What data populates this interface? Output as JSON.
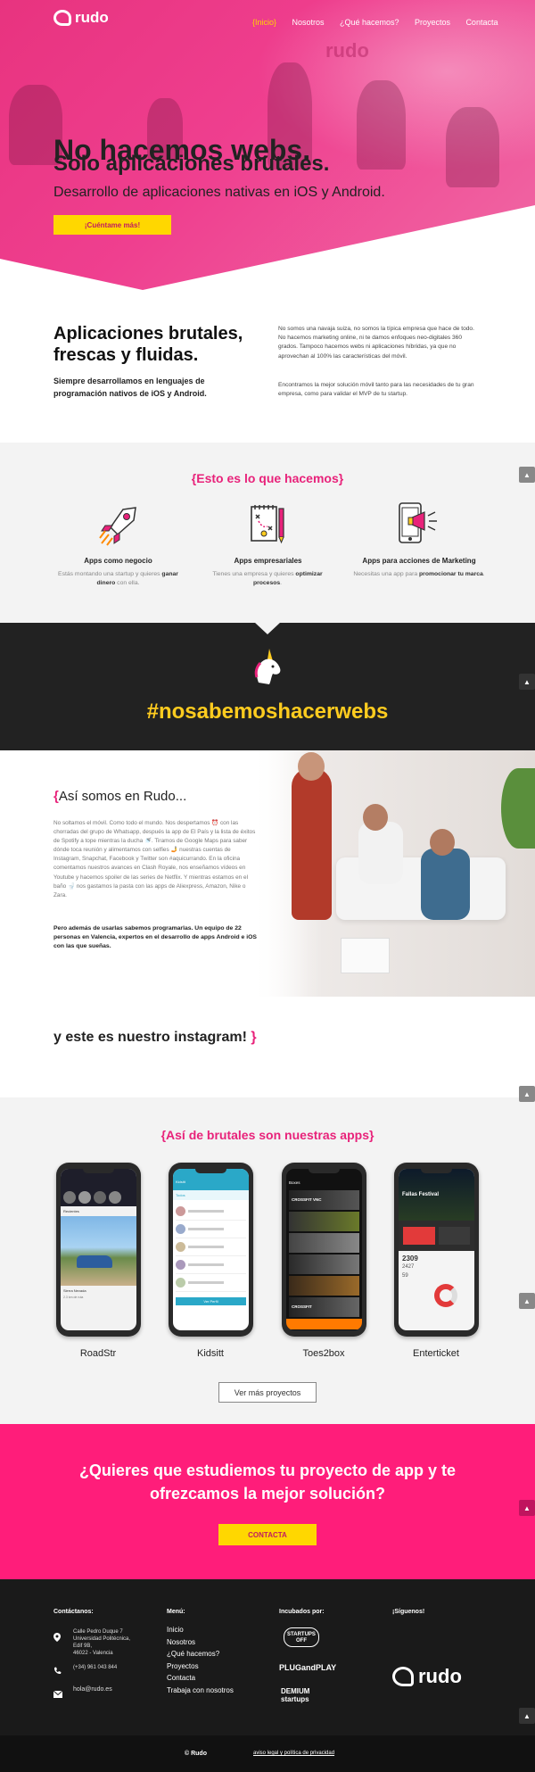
{
  "header": {
    "logo_text": "rudo",
    "nav": [
      "{Inicio}",
      "Nosotros",
      "¿Qué hacemos?",
      "Proyectos",
      "Contacta"
    ]
  },
  "hero": {
    "line1": "No hacemos webs.",
    "line2": "Solo aplicaciones brutales.",
    "subtitle": "Desarrollo de aplicaciones nativas en iOS y Android.",
    "button": "¡Cuéntame más!",
    "wall_logo": "rudo"
  },
  "intro": {
    "title": "Aplicaciones brutales, frescas y fluidas.",
    "subtitle": "Siempre desarrollamos en lenguajes de programación nativos de iOS y Android.",
    "para1": "No somos una navaja suiza, no somos la típica empresa que hace de todo. No hacemos marketing online, ni te damos enfoques neo-digitales 360 grados. Tampoco hacemos webs ni aplicaciones híbridas, ya que no aprovechan al 100% las características del móvil.",
    "para2": "Encontramos la mejor solución móvil tanto para las necesidades de tu gran empresa, como para validar el MVP de tu startup."
  },
  "services": {
    "title": "Esto es lo que hacemos",
    "items": [
      {
        "icon": "rocket-icon",
        "name": "Apps como negocio",
        "desc_pre": "Estás montando una startup y quieres ",
        "desc_bold": "ganar dinero",
        "desc_post": " con ella."
      },
      {
        "icon": "clipboard-plan-icon",
        "name": "Apps empresariales",
        "desc_pre": "Tienes una empresa y quieres ",
        "desc_bold": "optimizar procesos",
        "desc_post": "."
      },
      {
        "icon": "phone-megaphone-icon",
        "name": "Apps para acciones de Marketing",
        "desc_pre": "Necesitas una app para ",
        "desc_bold": "promocionar tu marca",
        "desc_post": "."
      }
    ]
  },
  "hashtag": "#nosabemoshacerwebs",
  "team": {
    "title": "Así somos en Rudo...",
    "text": "No soltamos el móvil. Como todo el mundo. Nos despertamos ⏰ con las chorradas del grupo de Whatsapp, después la app de El País y la lista de éxitos de Spotify a tope mientras la ducha 🚿. Tiramos de Google Maps para saber dónde toca reunión y alimentamos con selfies 🤳 nuestras cuentas de Instagram, Snapchat, Facebook y Twitter son #aquicurrando. En la oficina comentamos nuestros avances en Clash Royale, nos enseñamos vídeos en Youtube y hacemos spoiler de las series de Netflix. Y mientras estamos en el baño 🚽 nos gastamos la pasta con las apps de Aliexpress, Amazon, Nike o Zara.",
    "bold": "Pero además de usarlas sabemos programarlas. Un equipo de 22 personas en Valencia, expertos en el desarrollo de apps Android e iOS con las que sueñas."
  },
  "instagram": {
    "text": "y este es nuestro instagram!"
  },
  "apps": {
    "title": "Así de brutales son nuestras apps",
    "items": [
      {
        "name": "RoadStr",
        "screen_text": [
          "Recientes",
          "Sierra Nevada",
          "2.3 km de ruta"
        ]
      },
      {
        "name": "Kidsitt",
        "screen_text": [
          "Kidsitt",
          "Todos",
          "Ver Perfil"
        ]
      },
      {
        "name": "Toes2box",
        "screen_text": [
          "Boxes",
          "CROSSFIT VNC",
          "CROSSFIT"
        ]
      },
      {
        "name": "Enterticket",
        "screen_text": [
          "Fallas Festival",
          "2309",
          "2427",
          "59"
        ]
      }
    ],
    "more_button": "Ver más proyectos"
  },
  "cta": {
    "title": "¿Quieres que estudiemos tu proyecto de app y te ofrezcamos la mejor solución?",
    "button": "CONTACTA"
  },
  "footer": {
    "contact_title": "Contáctanos:",
    "address": [
      "Calle Pedro Duque 7",
      "Universidad Politécnica,",
      "Edif 9B,",
      "46022 - Valencia"
    ],
    "phone": "(+34) 961 043 844",
    "email": "hola@rudo.es",
    "menu_title": "Menú:",
    "menu": [
      "Inicio",
      "Nosotros",
      "¿Qué hacemos?",
      "Proyectos",
      "Contacta",
      "Trabaja con nosotros"
    ],
    "incubated_title": "Incubados por:",
    "incubators": [
      "STARTUPS OFF",
      "PLUGandPLAY",
      "DEMIUM startups"
    ],
    "follow_title": "¡Síguenos!",
    "logo_text": "rudo",
    "copyright": "© Rudo",
    "legal": "aviso legal y política de privacidad"
  },
  "colors": {
    "pink": "#e8227a",
    "yellow": "#ffd700",
    "dark": "#222222"
  }
}
